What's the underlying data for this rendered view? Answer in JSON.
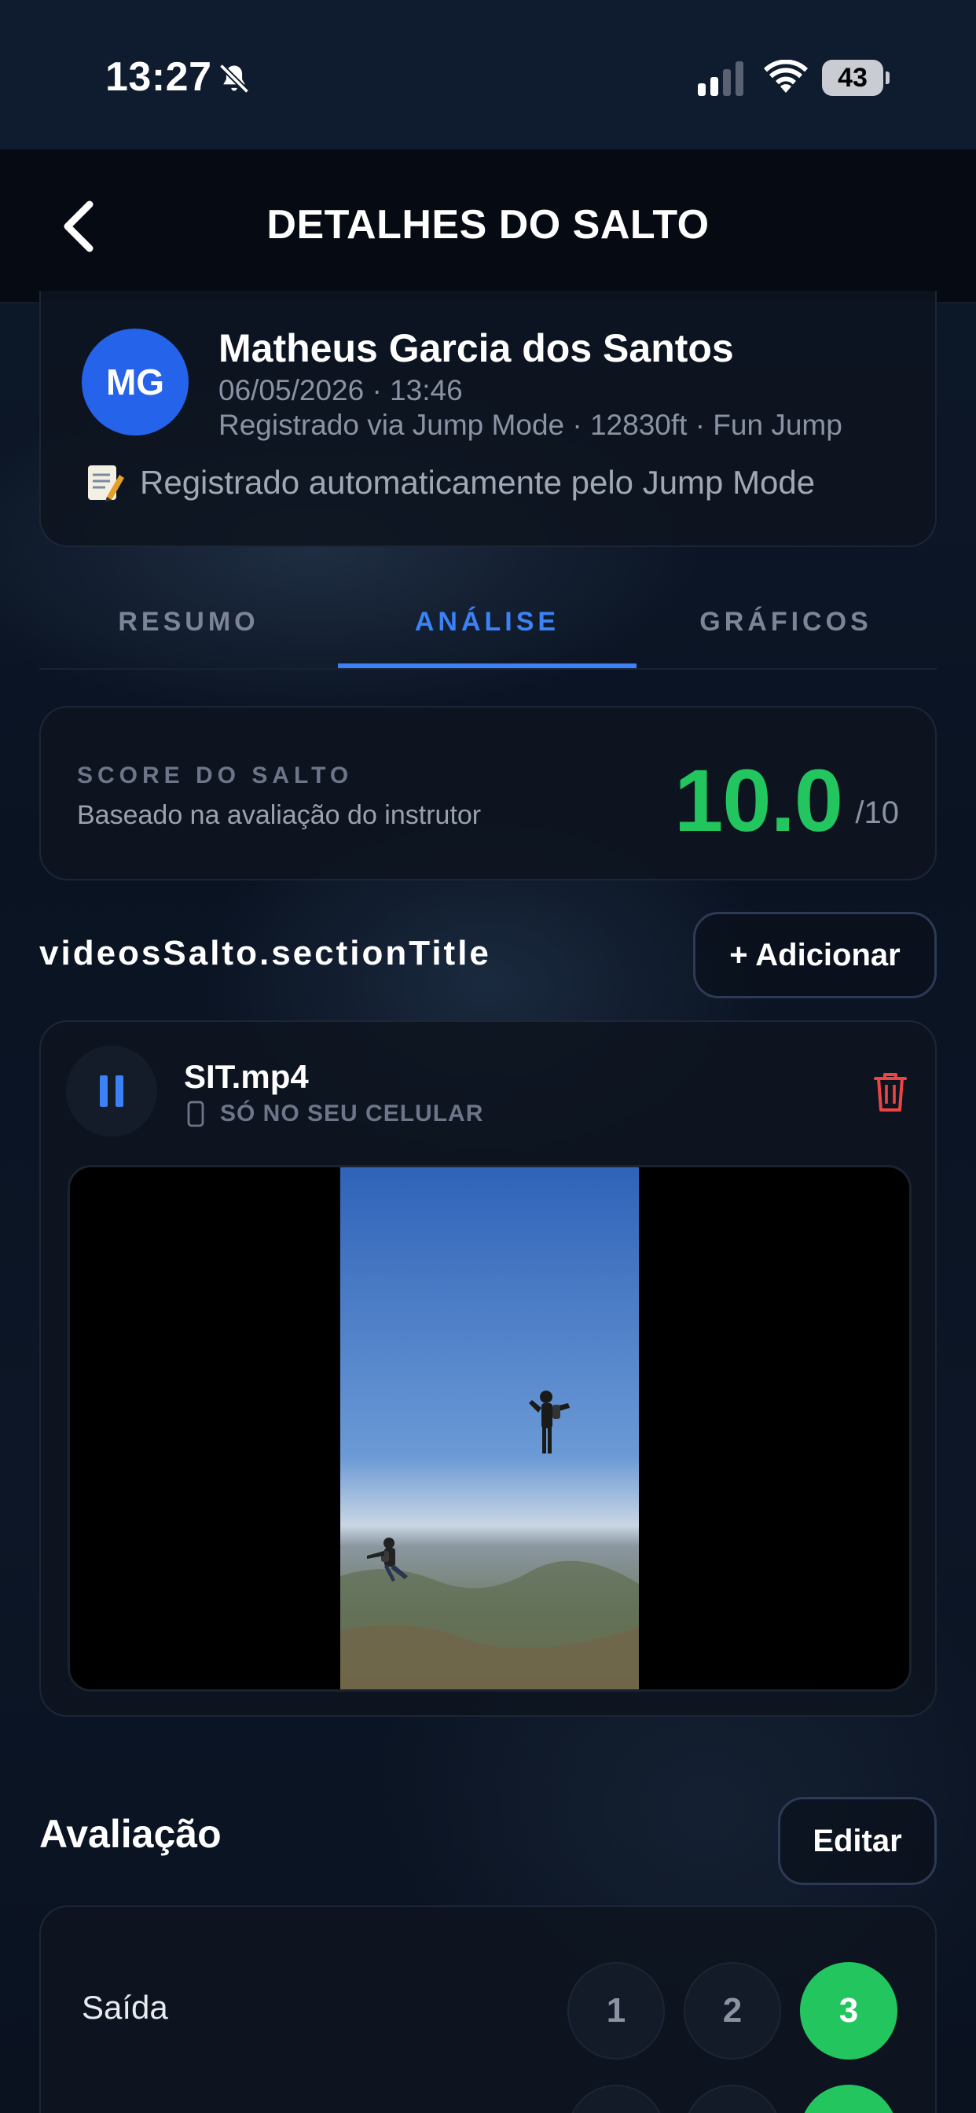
{
  "status_bar": {
    "time": "13:27",
    "battery": "43",
    "icons": [
      "bell-slash-icon",
      "signal-icon",
      "wifi-icon",
      "battery-icon"
    ]
  },
  "header": {
    "title": "DETALHES DO SALTO",
    "back_icon": "chevron-left-icon"
  },
  "profile": {
    "initials": "MG",
    "name": "Matheus Garcia dos Santos",
    "date": "06/05/2026 · 13:46",
    "meta": "Registrado via Jump Mode · 12830ft · Fun Jump",
    "note": "Registrado automaticamente pelo Jump Mode",
    "note_icon": "memo-icon",
    "avatar_color": "#2563eb"
  },
  "tabs": [
    {
      "label": "RESUMO",
      "active": false
    },
    {
      "label": "ANÁLISE",
      "active": true
    },
    {
      "label": "GRÁFICOS",
      "active": false
    }
  ],
  "score": {
    "label": "SCORE DO SALTO",
    "subtitle": "Baseado na avaliação do instrutor",
    "value": "10.0",
    "max": "/10",
    "color": "#22c55e"
  },
  "videos": {
    "section_title": "videosSalto.sectionTitle",
    "add_label": "+ Adicionar",
    "items": [
      {
        "file_name": "SIT.mp4",
        "status": "SÓ NO SEU CELULAR",
        "state_icon": "pause-icon",
        "delete_icon": "trash-icon"
      }
    ]
  },
  "evaluation": {
    "title": "Avaliação",
    "edit_label": "Editar",
    "rows": [
      {
        "label": "Saída",
        "options": [
          "1",
          "2",
          "3"
        ],
        "selected": "3"
      }
    ]
  },
  "colors": {
    "accent": "#3b82f6",
    "success": "#22c55e",
    "danger": "#ef4444"
  }
}
